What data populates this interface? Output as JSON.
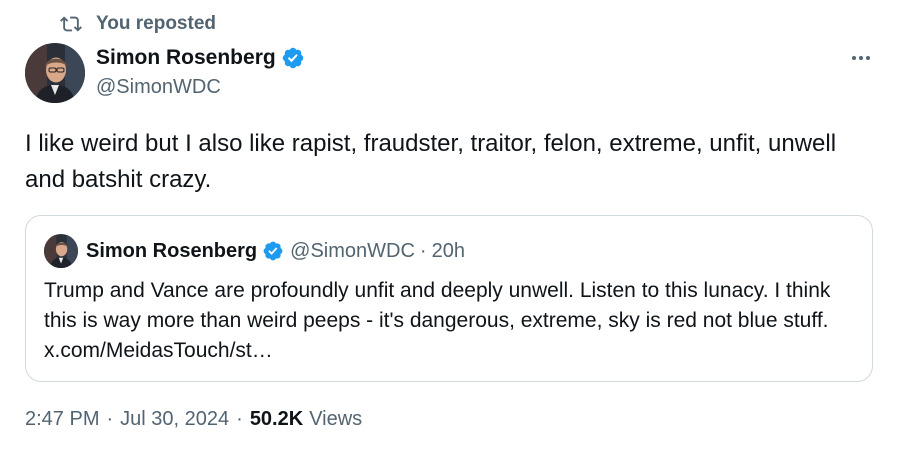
{
  "repost": {
    "label": "You reposted"
  },
  "author": {
    "name": "Simon Rosenberg",
    "handle": "@SimonWDC"
  },
  "tweet": {
    "text": "I like weird but I also like rapist, fraudster, traitor, felon, extreme, unfit, unwell and batshit crazy."
  },
  "quoted": {
    "name": "Simon Rosenberg",
    "handle": "@SimonWDC",
    "separator": "·",
    "time": "20h",
    "text": "Trump and Vance are profoundly unfit and deeply unwell.  Listen to this lunacy. I think this is way more than weird peeps - it's dangerous, extreme, sky is red not blue stuff. x.com/MeidasTouch/st…"
  },
  "meta": {
    "time": "2:47 PM",
    "separator": "·",
    "date": "Jul 30, 2024",
    "views_count": "50.2K",
    "views_label": "Views"
  },
  "colors": {
    "verified": "#1d9bf0",
    "secondary": "#536471",
    "text": "#0f1419",
    "border": "#cfd9de"
  },
  "icons": {
    "repost": "repost-icon",
    "verified": "verified-badge-icon",
    "more": "more-options-icon"
  }
}
